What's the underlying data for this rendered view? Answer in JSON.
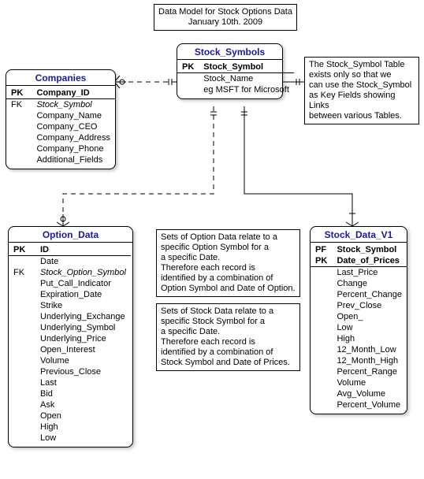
{
  "title_line1": "Data Model for Stock Options Data",
  "title_line2": "January 10th. 2009",
  "note_symbol": [
    "The Stock_Symbol Table",
    "exists only so that we",
    "can use the Stock_Symbol",
    "as Key Fields showing Links",
    "between various Tables."
  ],
  "note_option": [
    "Sets of Option Data relate to a",
    "specific Option Symbol for a",
    "a specific Date.",
    "Therefore each record is",
    "identified by a combination of",
    "Option Symbol and Date of Option."
  ],
  "note_stock": [
    "Sets of Stock Data relate to a",
    "specific Stock Symbol for a",
    "a specific Date.",
    "Therefore each record is",
    "identified by a combination of",
    "Stock Symbol and Date of Prices."
  ],
  "entities": {
    "companies": {
      "name": "Companies",
      "pk": [
        [
          "PK",
          "Company_ID"
        ]
      ],
      "fields": [
        [
          "FK",
          "Stock_Symbol",
          "ital"
        ],
        [
          "",
          "Company_Name",
          ""
        ],
        [
          "",
          "Company_CEO",
          ""
        ],
        [
          "",
          "Company_Address",
          ""
        ],
        [
          "",
          "Company_Phone",
          ""
        ],
        [
          "",
          "Additional_Fields",
          ""
        ]
      ]
    },
    "symbols": {
      "name": "Stock_Symbols",
      "pk": [
        [
          "PK",
          "Stock_Symbol"
        ]
      ],
      "fields": [
        [
          "",
          "Stock_Name",
          ""
        ],
        [
          "",
          "eg MSFT for Microsoft",
          ""
        ]
      ]
    },
    "optiondata": {
      "name": "Option_Data",
      "pk": [
        [
          "PK",
          "ID"
        ]
      ],
      "fields": [
        [
          "",
          "Date",
          ""
        ],
        [
          "FK",
          "Stock_Option_Symbol",
          "ital"
        ],
        [
          "",
          "Put_Call_Indicator",
          ""
        ],
        [
          "",
          "Expiration_Date",
          ""
        ],
        [
          "",
          "Strike",
          ""
        ],
        [
          "",
          "Underlying_Exchange",
          ""
        ],
        [
          "",
          "Underlying_Symbol",
          ""
        ],
        [
          "",
          "Underlying_Price",
          ""
        ],
        [
          "",
          "Open_Interest",
          ""
        ],
        [
          "",
          "Volume",
          ""
        ],
        [
          "",
          "Previous_Close",
          ""
        ],
        [
          "",
          "Last",
          ""
        ],
        [
          "",
          "Bid",
          ""
        ],
        [
          "",
          "Ask",
          ""
        ],
        [
          "",
          "Open",
          ""
        ],
        [
          "",
          "High",
          ""
        ],
        [
          "",
          "Low",
          ""
        ]
      ]
    },
    "stockdata": {
      "name": "Stock_Data_V1",
      "pk": [
        [
          "PF",
          "Stock_Symbol"
        ],
        [
          "PK",
          "Date_of_Prices"
        ]
      ],
      "fields": [
        [
          "",
          "Last_Price",
          ""
        ],
        [
          "",
          "Change",
          ""
        ],
        [
          "",
          "Percent_Change",
          ""
        ],
        [
          "",
          "Prev_Close",
          ""
        ],
        [
          "",
          "Open_",
          ""
        ],
        [
          "",
          "Low",
          ""
        ],
        [
          "",
          "High",
          ""
        ],
        [
          "",
          "12_Month_Low",
          ""
        ],
        [
          "",
          "12_Month_High",
          ""
        ],
        [
          "",
          "Percent_Range",
          ""
        ],
        [
          "",
          "Volume",
          ""
        ],
        [
          "",
          "Avg_Volume",
          ""
        ],
        [
          "",
          "Percent_Volume",
          ""
        ]
      ]
    }
  }
}
